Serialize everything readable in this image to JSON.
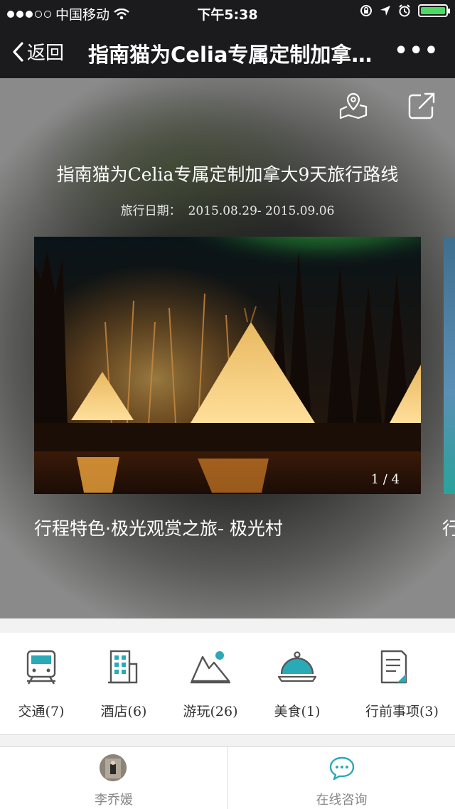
{
  "status_bar": {
    "carrier": "中国移动",
    "time": "下午5:38"
  },
  "nav": {
    "back_label": "返回",
    "title": "指南猫为Celia专属定制加拿…",
    "more_label": "•••"
  },
  "hero": {
    "title": "指南猫为Celia专属定制加拿大9天旅行路线",
    "date_label": "旅行日期：",
    "date_value": "2015.08.29- 2015.09.06",
    "counter": "1 / 4",
    "caption": "行程特色·极光观赏之旅- 极光村",
    "caption_next": "行"
  },
  "categories": [
    {
      "label": "交通(7)",
      "icon": "train-icon"
    },
    {
      "label": "酒店(6)",
      "icon": "hotel-icon"
    },
    {
      "label": "游玩(26)",
      "icon": "mountain-icon"
    },
    {
      "label": "美食(1)",
      "icon": "food-cloche-icon"
    },
    {
      "label": "行前事项(3)",
      "icon": "document-icon"
    }
  ],
  "bottom": {
    "left_label": "李乔媛",
    "right_label": "在线咨询"
  },
  "colors": {
    "accent": "#2aa9b7",
    "nav_bg": "#1b1b1d"
  }
}
